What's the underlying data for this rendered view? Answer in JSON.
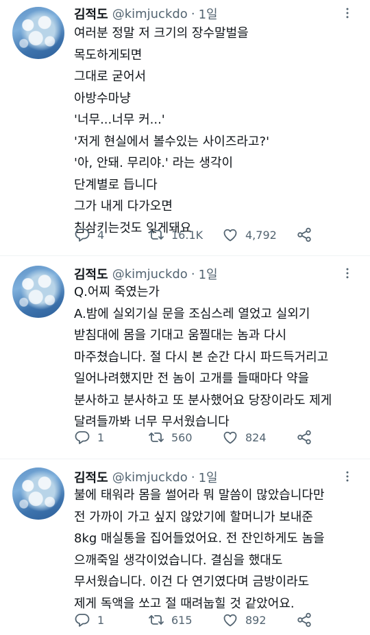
{
  "tweets": [
    {
      "name": "김적도",
      "handle": "@kimjuckdo",
      "separator": "·",
      "time": "1일",
      "lines": [
        "여러분 정말 저 크기의 장수말벌을",
        "목도하게되면",
        "그대로 굳어서",
        "아방수마냥",
        "'너무...너무 커...'",
        "'저게 현실에서 볼수있는 사이즈라고?'",
        "'아, 안돼. 무리야.' 라는 생각이",
        "단계별로 듭니다",
        "그가 내게 다가오면",
        "침삼키는것도 잊게돼요"
      ],
      "reply_count": "4",
      "retweet_count": "16.1K",
      "like_count": "4,792"
    },
    {
      "name": "김적도",
      "handle": "@kimjuckdo",
      "separator": "·",
      "time": "1일",
      "lines": [
        "Q.어찌 죽였는가",
        "A.밤에 실외기실 문을 조심스레 열었고 실외기",
        "받침대에 몸을 기대고 움찔대는 놈과 다시",
        "마주쳤습니다. 절 다시 본 순간 다시 파드득거리고",
        "일어나려했지만 전 놈이 고개를 들때마다 약을",
        "분사하고 분사하고 또 분사했어요 당장이라도 제게",
        "달려들까봐 너무 무서웠습니다"
      ],
      "reply_count": "1",
      "retweet_count": "560",
      "like_count": "824"
    },
    {
      "name": "김적도",
      "handle": "@kimjuckdo",
      "separator": "·",
      "time": "1일",
      "lines": [
        "불에 태워라 몸을 썰어라 뭐 말씀이 많았습니다만",
        "전 가까이 가고 싶지 않았기에 할머니가 보내준",
        "8kg 매실통을 집어들었어요. 전 잔인하게도 놈을",
        "으깨죽일 생각이었습니다. 결심을 했대도",
        "무서웠습니다. 이건 다 연기였다며 금방이라도",
        "제게 독액을 쏘고 절 때려눕힐 것 같았어요."
      ],
      "reply_count": "1",
      "retweet_count": "615",
      "like_count": "892"
    }
  ],
  "icons": {
    "more": "more-dots-icon",
    "reply": "reply-bubble-icon",
    "retweet": "retweet-arrows-icon",
    "like": "heart-icon",
    "share": "share-nodes-icon"
  },
  "colors": {
    "text": "#0f1419",
    "secondary": "#536471",
    "divider": "#eff3f4"
  }
}
